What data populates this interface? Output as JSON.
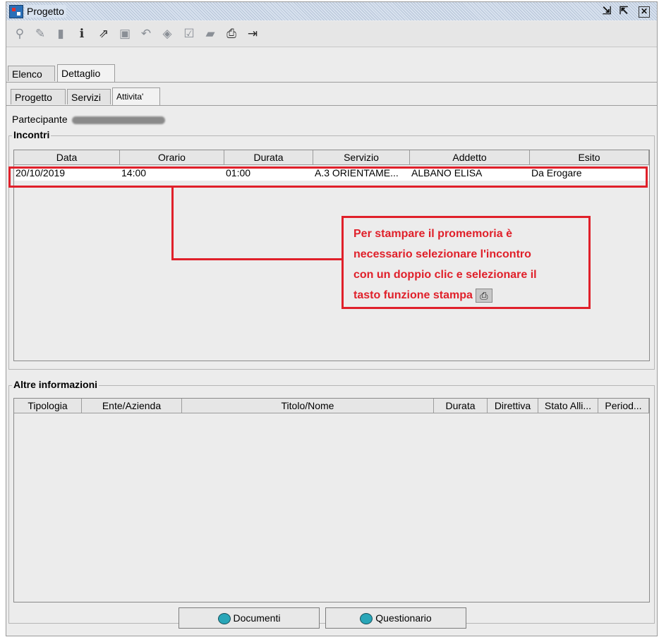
{
  "window": {
    "title": "Progetto",
    "controls": [
      "restore-icon",
      "maximize-icon",
      "close-icon"
    ]
  },
  "toolbar": {
    "tools": [
      "search-icon",
      "edit-icon",
      "new-icon",
      "info-icon",
      "export-icon",
      "save-icon",
      "undo-icon",
      "delete-icon",
      "check-icon",
      "folder-icon",
      "print-icon",
      "exit-icon"
    ]
  },
  "tabs_main": [
    {
      "label": "Elenco"
    },
    {
      "label": "Dettaglio"
    }
  ],
  "tabs_sub": [
    {
      "label": "Progetto"
    },
    {
      "label": "Servizi"
    },
    {
      "label": "Attivita'"
    }
  ],
  "participant": {
    "label": "Partecipante"
  },
  "incontri": {
    "title": "Incontri",
    "columns": [
      "Data",
      "Orario",
      "Durata",
      "Servizio",
      "Addetto",
      "Esito"
    ],
    "rows": [
      [
        "20/10/2019",
        "14:00",
        "01:00",
        "A.3 ORIENTAME...",
        "ALBANO ELISA",
        "Da Erogare"
      ]
    ]
  },
  "callout": {
    "lines": [
      "Per stampare il promemoria è",
      "necessario selezionare  l'incontro",
      "con un doppio clic e selezionare il",
      "tasto funzione stampa"
    ],
    "icon": "print-icon",
    "color": "#e0202a"
  },
  "altre": {
    "title": "Altre informazioni",
    "columns": [
      "Tipologia",
      "Ente/Azienda",
      "Titolo/Nome",
      "Durata",
      "Direttiva",
      "Stato Alli...",
      "Period..."
    ]
  },
  "buttons": {
    "documenti": "Documenti",
    "questionario": "Questionario"
  }
}
